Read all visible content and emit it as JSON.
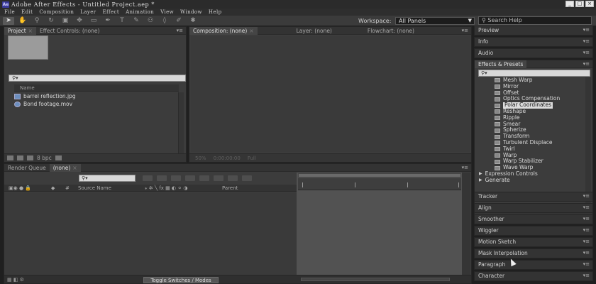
{
  "window": {
    "title": "Adobe After Effects - Untitled Project.aep *",
    "logo": "Ae",
    "controls": [
      "_",
      "□",
      "×"
    ]
  },
  "menubar": {
    "items": [
      "File",
      "Edit",
      "Composition",
      "Layer",
      "Effect",
      "Animation",
      "View",
      "Window",
      "Help"
    ]
  },
  "toolbar": {
    "tools": [
      "selection-tool",
      "hand-tool",
      "zoom-tool",
      "rotate-tool",
      "camera-tool",
      "pan-behind-tool",
      "mask-tool",
      "pen-tool",
      "type-tool",
      "brush-tool",
      "clone-tool",
      "eraser-tool",
      "roto-tool",
      "puppet-tool"
    ],
    "workspace_label": "Workspace:",
    "workspace_value": "All Panels",
    "search_placeholder": "Search Help"
  },
  "project_panel": {
    "tabs": [
      "Project",
      "Effect Controls: (none)"
    ],
    "search_value": "",
    "column_name": "Name",
    "files": [
      {
        "name": "barrel reflection.jpg",
        "icon": "image-file-icon"
      },
      {
        "name": "Bond footage.mov",
        "icon": "movie-file-icon"
      }
    ],
    "bit_depth": "8 bpc"
  },
  "composition_panel": {
    "tabs": [
      "Composition: (none)",
      "Layer: (none)",
      "Flowchart: (none)"
    ],
    "footer": [
      "50%",
      "0:00:00:00",
      "Full"
    ]
  },
  "timeline_panel": {
    "tabs": [
      "Render Queue",
      "(none)"
    ],
    "columns": [
      "#",
      "Source Name",
      "Parent"
    ],
    "toggle_label": "Toggle Switches / Modes"
  },
  "right_panels": {
    "top": [
      "Preview",
      "Info",
      "Audio"
    ],
    "effects_title": "Effects & Presets",
    "effects": [
      "Mesh Warp",
      "Mirror",
      "Offset",
      "Optics Compensation",
      "Polar Coordinates",
      "Reshape",
      "Ripple",
      "Smear",
      "Spherize",
      "Transform",
      "Turbulent Displace",
      "Twirl",
      "Warp",
      "Warp Stabilizer",
      "Wave Warp"
    ],
    "selected_effect": "Polar Coordinates",
    "categories": [
      "Expression Controls",
      "Generate"
    ],
    "bottom": [
      "Tracker",
      "Align",
      "Smoother",
      "Wiggler",
      "Motion Sketch",
      "Mask Interpolation",
      "Paragraph",
      "Character"
    ]
  },
  "colors": {
    "background": "#1f1f1f",
    "panel": "#3c3c3c",
    "tab_bar": "#333333",
    "selection": "#dcdcdc",
    "workarea": "#d4a017"
  }
}
